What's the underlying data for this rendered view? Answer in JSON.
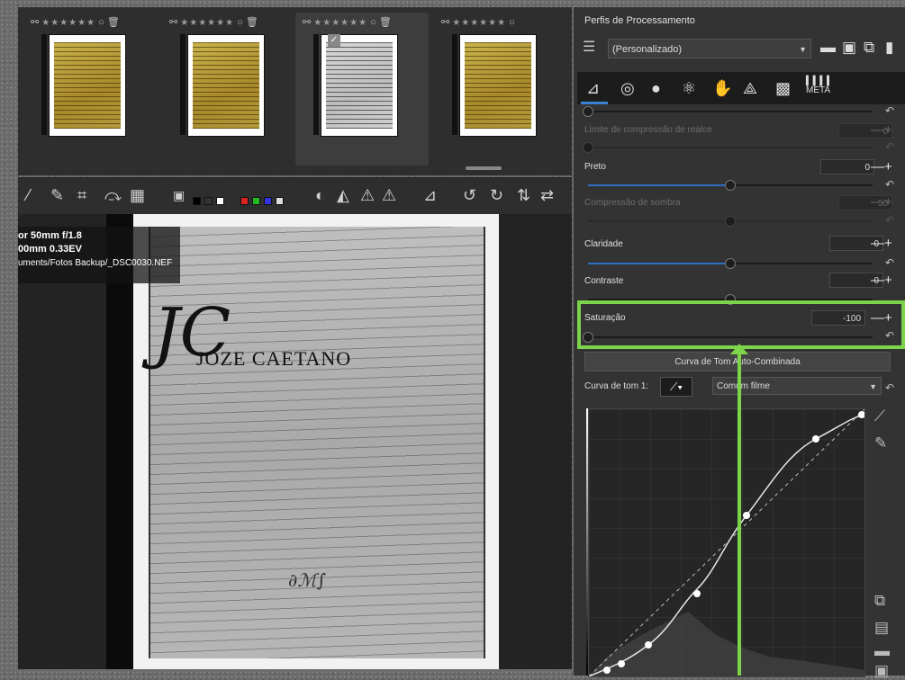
{
  "filmstrip": {
    "thumbs": [
      {
        "stars": "★★★★★★",
        "tone": "yellow"
      },
      {
        "stars": "★★★★★★",
        "tone": "yellow"
      },
      {
        "stars": "★★★★★★",
        "tone": "gray",
        "selected": true
      },
      {
        "stars": "★★★★★★",
        "tone": "yellow"
      }
    ]
  },
  "preview": {
    "info_line1": "or 50mm f/1.8",
    "info_line2": "00mm  0.33EV",
    "info_line3": "uments/Fotos Backup/_DSC0030.NEF",
    "doc_title": "JOZE CAETANO"
  },
  "panel": {
    "title": "Perfis de Processamento",
    "profile_value": "(Personalizado)",
    "meta_tab_label": "META",
    "sliders": [
      {
        "label": "",
        "value": "",
        "dim": false,
        "knob": 0.0
      },
      {
        "label": "Limite de compressão de realce",
        "value": "0",
        "dim": true,
        "knob": 0.0
      },
      {
        "label": "Preto",
        "value": "0",
        "dim": false,
        "knob": 0.5
      },
      {
        "label": "Compressão de sombra",
        "value": "50",
        "dim": true,
        "knob": 0.5
      },
      {
        "label": "Claridade",
        "value": "0",
        "dim": false,
        "knob": 0.5
      },
      {
        "label": "Contraste",
        "value": "0",
        "dim": false,
        "knob": 0.5
      },
      {
        "label": "Saturação",
        "value": "-100",
        "dim": false,
        "knob": 0.0
      }
    ],
    "curve_button_label": "Curva de Tom Auto-Combinada",
    "curve_label": "Curva de tom 1:",
    "curve_mode": "Comum filme"
  },
  "colors": {
    "highlight": "#7dd34a",
    "accent": "#2c6fc4"
  }
}
